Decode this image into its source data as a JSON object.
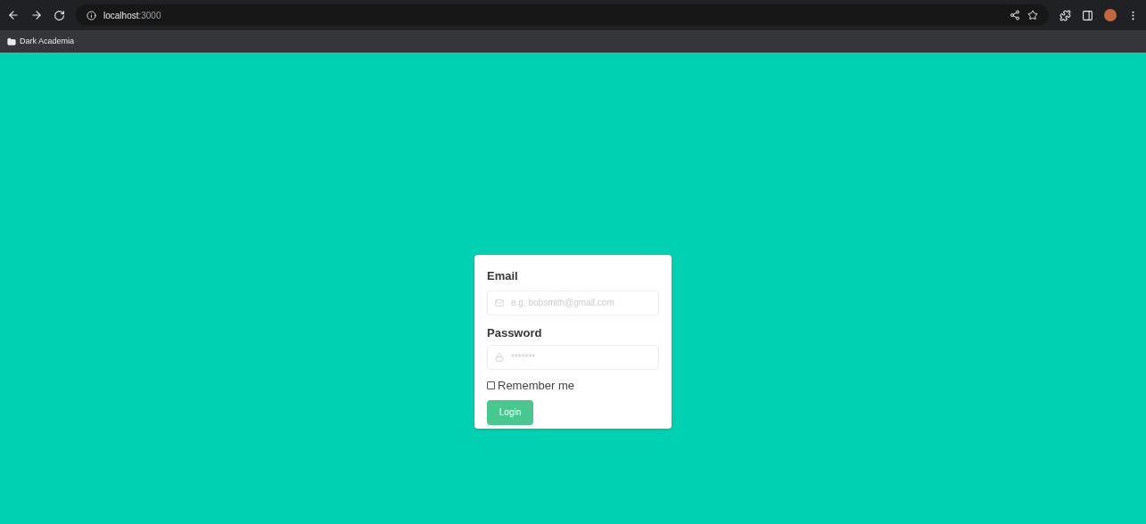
{
  "browser": {
    "url_host": "localhost",
    "url_port": ":3000",
    "bookmarks": [
      {
        "label": "Dark Academia"
      }
    ]
  },
  "login_form": {
    "email": {
      "label": "Email",
      "placeholder": "e.g. bobsmith@gmail.com"
    },
    "password": {
      "label": "Password",
      "placeholder": "*******"
    },
    "remember": {
      "label": "Remember me",
      "checked": false
    },
    "submit": "Login"
  }
}
